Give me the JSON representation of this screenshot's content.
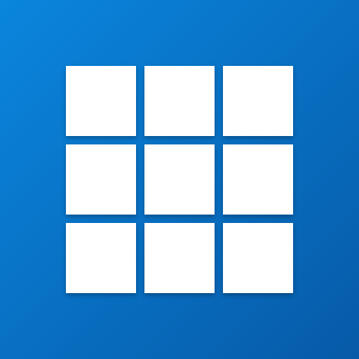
{
  "icon": {
    "name": "grid-icon",
    "background_colors": [
      "#0a86dd",
      "#075aa8"
    ],
    "tile_color": "#ffffff",
    "grid": {
      "rows": 3,
      "columns": 3
    }
  }
}
